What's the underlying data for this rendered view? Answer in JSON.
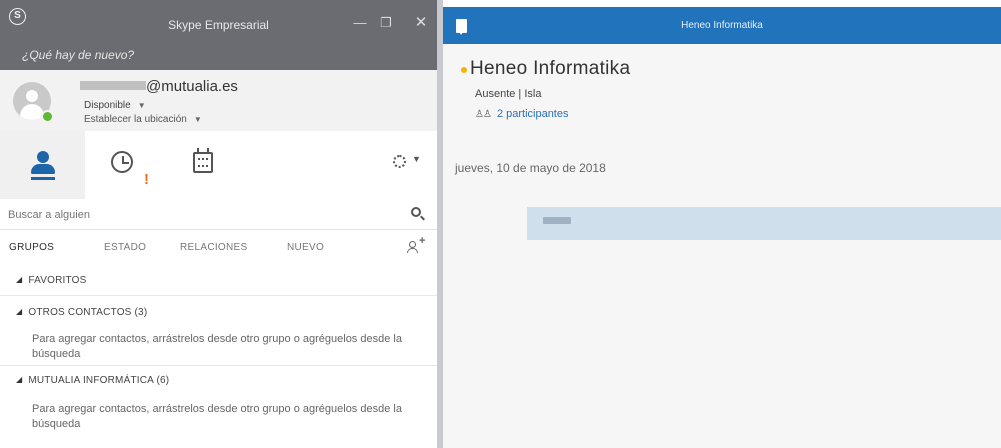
{
  "left_window": {
    "app_title": "Skype Empresarial",
    "whats_new": "¿Qué hay de nuevo?",
    "window_buttons": {
      "minimize": "—",
      "maximize": "❐",
      "close": "✕"
    },
    "account": {
      "email_domain": "@mutualia.es",
      "status": "Disponible",
      "location": "Establecer la ubicación"
    },
    "alert_mark": "!",
    "search": {
      "placeholder": "Buscar a alguien"
    },
    "tabs": [
      "GRUPOS",
      "ESTADO",
      "RELACIONES",
      "NUEVO"
    ],
    "groups": [
      {
        "name": "FAVORITOS",
        "hint": ""
      },
      {
        "name": "OTROS CONTACTOS (3)",
        "hint": "Para agregar contactos, arrástrelos desde otro grupo o agréguelos desde la búsqueda"
      },
      {
        "name": "MUTUALIA INFORMÁTICA (6)",
        "hint": "Para agregar contactos, arrástrelos desde otro grupo o agréguelos desde la búsqueda"
      }
    ]
  },
  "right_window": {
    "title": "Heneo Informatika",
    "contact_name": "Heneo Informatika",
    "status": "Ausente | Isla",
    "participants": "2 participantes",
    "date": "jueves, 10 de mayo de 2018"
  },
  "colors": {
    "skype_title_bg": "#6b6b72",
    "conversation_title_bg": "#2173bb",
    "presence_available": "#5fb832",
    "presence_away": "#f4b400",
    "message_bubble": "#cfdfec",
    "accent_blue": "#1d64a8"
  }
}
